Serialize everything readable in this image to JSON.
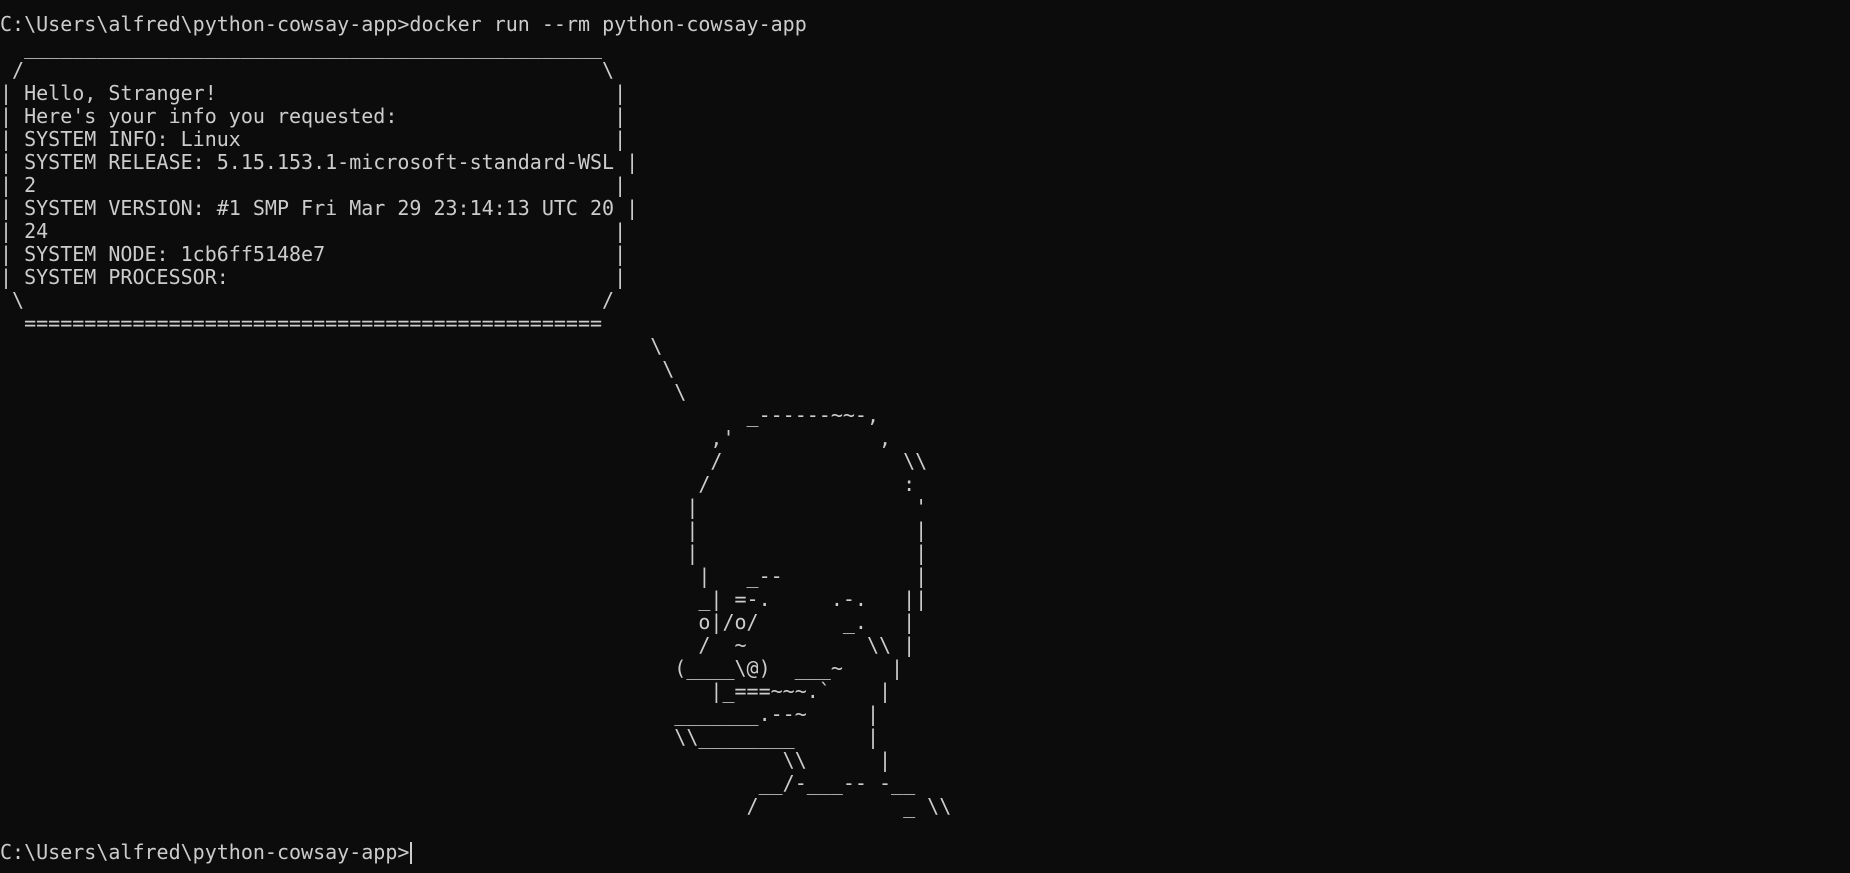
{
  "terminal": {
    "command_prompt": "C:\\Users\\alfred\\python-cowsay-app>",
    "command": "docker run --rm python-cowsay-app",
    "output_lines": [
      "  ________________________________________________",
      " /                                                \\",
      "| Hello, Stranger!                                 |",
      "| Here's your info you requested:                  |",
      "| SYSTEM INFO: Linux                               |",
      "| SYSTEM RELEASE: 5.15.153.1-microsoft-standard-WSL |",
      "| 2                                                |",
      "| SYSTEM VERSION: #1 SMP Fri Mar 29 23:14:13 UTC 20 |",
      "| 24                                               |",
      "| SYSTEM NODE: 1cb6ff5148e7                        |",
      "| SYSTEM PROCESSOR:                                |",
      " \\                                                /",
      "  ================================================",
      "                                                      \\",
      "                                                       \\",
      "                                                        \\",
      "                                                              _------~~-,",
      "                                                           ,'            ,",
      "                                                           /               \\\\",
      "                                                          /                :",
      "                                                         |                  '",
      "                                                         |                  |",
      "                                                         |                  |",
      "                                                          |   _--           |",
      "                                                          _| =-.     .-.   ||",
      "                                                          o|/o/       _.   |",
      "                                                          /  ~          \\\\ |",
      "                                                        (____\\@)  ___~    |",
      "                                                           |_===~~~.`    |",
      "                                                        _______.--~     |",
      "                                                        \\\\________      |",
      "                                                                 \\\\      |",
      "                                                               __/-___-- -__",
      "                                                              /            _ \\\\"
    ],
    "final_prompt": "C:\\Users\\alfred\\python-cowsay-app>"
  }
}
